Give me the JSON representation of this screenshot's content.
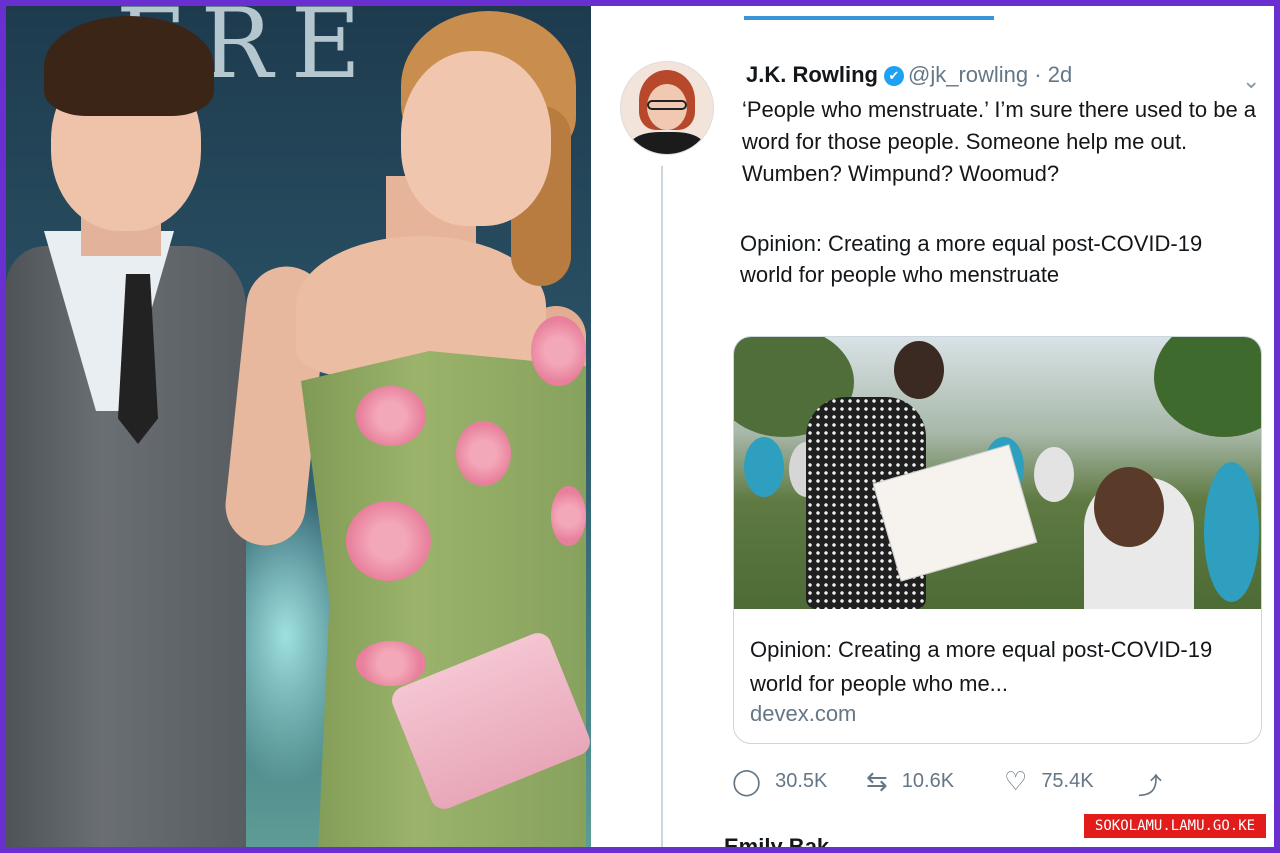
{
  "photo": {
    "background_sign": "FRE",
    "accent_colors": {
      "dress": "#9bb36b",
      "flowers": "#f3a8b8",
      "suit": "#6a6f73"
    }
  },
  "tweet": {
    "author_name": "J.K. Rowling",
    "verified_mark": "✔",
    "handle": "@jk_rowling",
    "separator": "·",
    "time": "2d",
    "menu_icon": "chevron-down",
    "text": "‘People who menstruate.’ I’m sure there used to be a word for those people. Someone help me out. Wumben? Wimpund? Woomud?",
    "quoted_text": "Opinion: Creating a more equal post-COVID-19 world for people who menstruate",
    "card": {
      "title": "Opinion: Creating a more equal post-COVID-19 world for people who me...",
      "domain": "devex.com"
    },
    "actions": {
      "replies": "30.5K",
      "retweets": "10.6K",
      "likes": "75.4K"
    },
    "next_tweet_author": "Emily Bak"
  },
  "watermark": "SOKOLAMU.LAMU.GO.KE",
  "colors": {
    "frame": "#6a2fd0",
    "verified": "#1da1f2",
    "indicator": "#3a95d6",
    "watermark_bg": "#e21b1b"
  }
}
